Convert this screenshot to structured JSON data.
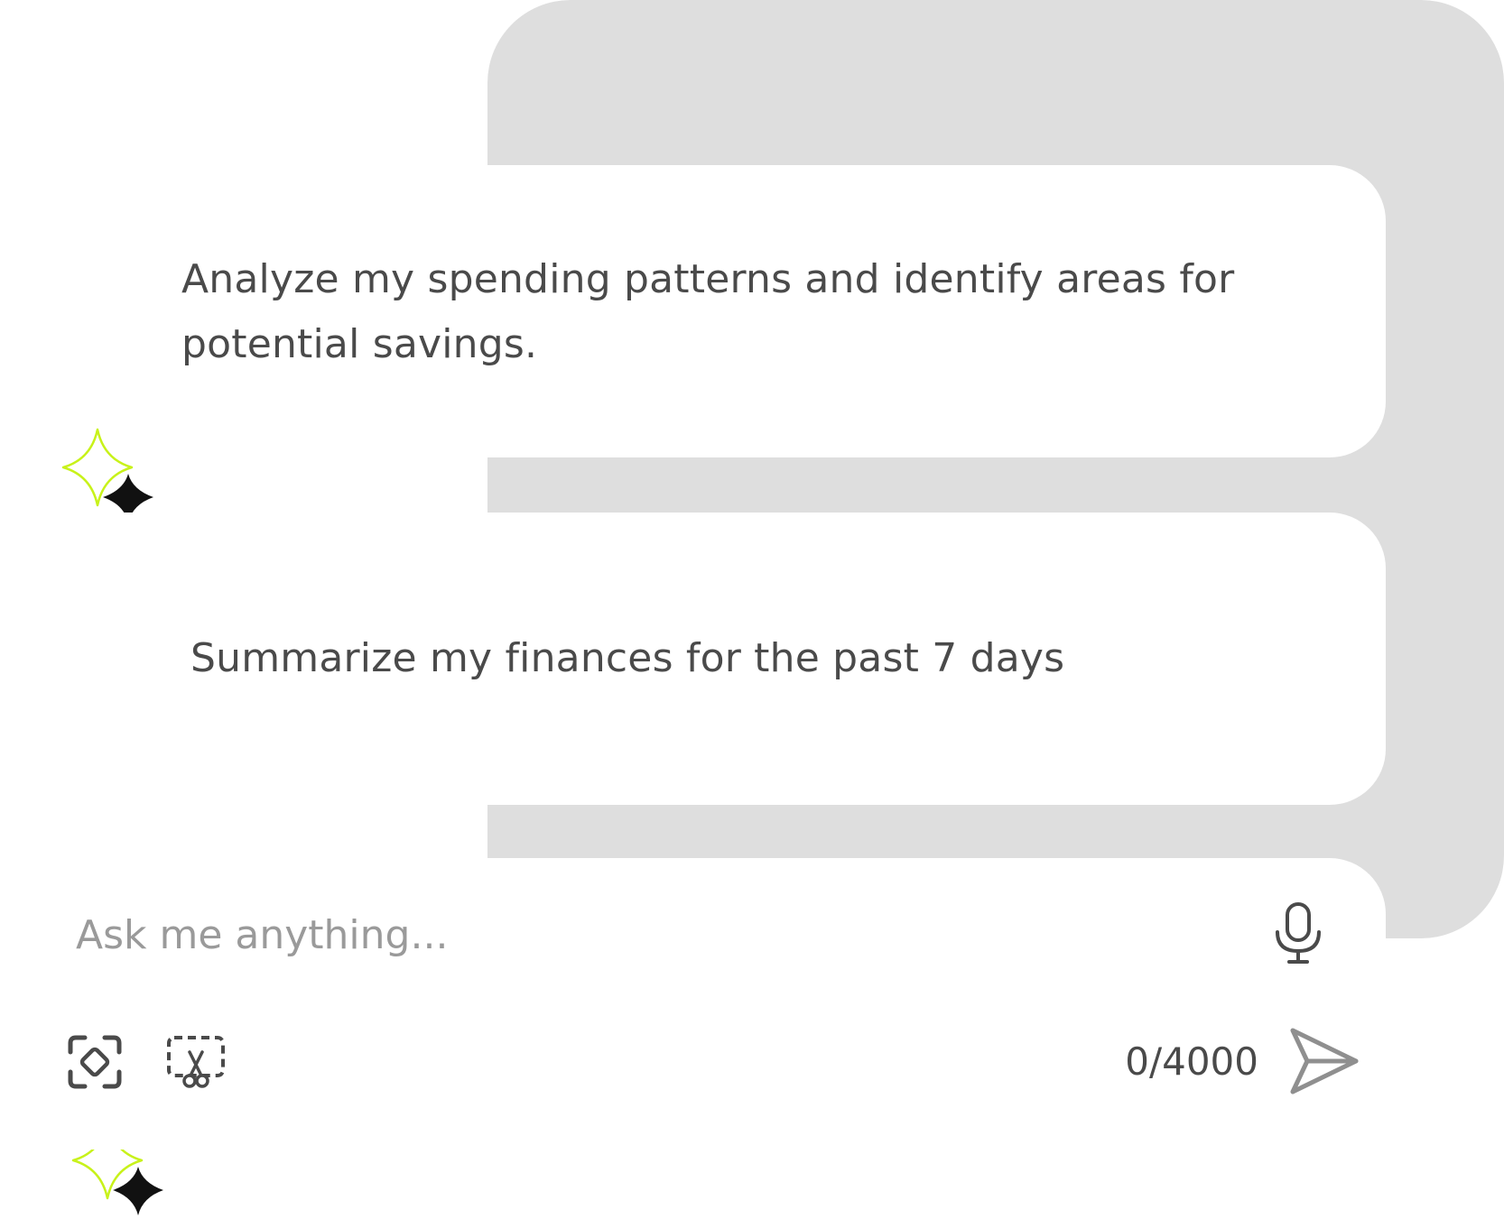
{
  "colors": {
    "backdrop": "#dedede",
    "card": "#ffffff",
    "text": "#4a4a4a",
    "placeholder": "#9a9a9a",
    "sparkle_outline": "#c8f21a",
    "sparkle_fill": "#111111",
    "send_icon": "#8f8f8f"
  },
  "suggestions": [
    {
      "icon": "sparkle-icon",
      "text": "Analyze my spending patterns and identify areas for potential savings."
    },
    {
      "icon": "sparkle-icon",
      "text": "Summarize my finances for the past 7 days"
    }
  ],
  "composer": {
    "placeholder": "Ask me anything...",
    "value": "",
    "counter": "0/4000",
    "icons": {
      "mic": "microphone-icon",
      "capture": "screen-capture-icon",
      "snip": "snip-tool-icon",
      "send": "send-icon"
    }
  }
}
